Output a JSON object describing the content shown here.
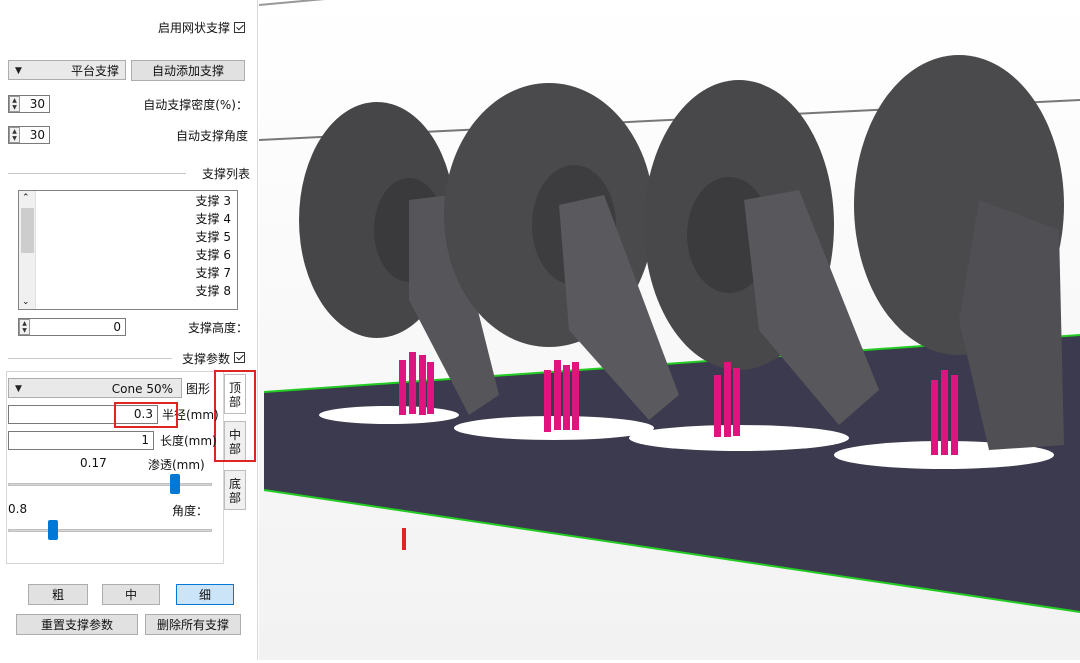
{
  "panel": {
    "enable_mesh_support": {
      "label": "启用网状支撑",
      "checked": true
    },
    "platform_dropdown": {
      "value": "平台支撑"
    },
    "auto_add_button": "自动添加支撑",
    "auto_density": {
      "label": "自动支撑密度(%)：",
      "value": "30"
    },
    "auto_angle": {
      "label": "自动支撑角度",
      "value": "30"
    },
    "support_list": {
      "title": "支撑列表",
      "items": [
        "支撑 3",
        "支撑 4",
        "支撑 5",
        "支撑 6",
        "支撑 7",
        "支撑 8"
      ]
    },
    "support_height": {
      "label": "支撑高度：",
      "value": "0"
    },
    "support_params": {
      "label": "支撑参数",
      "checked": true
    },
    "tabs": [
      "顶部",
      "中部",
      "底部"
    ],
    "shape": {
      "label": "图形",
      "value": "Cone 50%"
    },
    "radius": {
      "label": "半径(mm)",
      "value": "0.3"
    },
    "length": {
      "label": "长度(mm)",
      "value": "1"
    },
    "penetration": {
      "label": "渗透(mm)",
      "value": "0.17"
    },
    "angle": {
      "label": "角度：",
      "value": "0.8"
    },
    "size_buttons": {
      "thick": "粗",
      "medium": "中",
      "fine": "细",
      "selected": "fine"
    },
    "reset_button": "重置支撑参数",
    "delete_all_button": "删除所有支撑"
  },
  "colors": {
    "platform": "#3b3a4e",
    "platform_edge": "#22cc22",
    "model": "#4a4a4c",
    "supports": "#e0147f",
    "highlight": "#e02424",
    "accent": "#0078d7"
  }
}
